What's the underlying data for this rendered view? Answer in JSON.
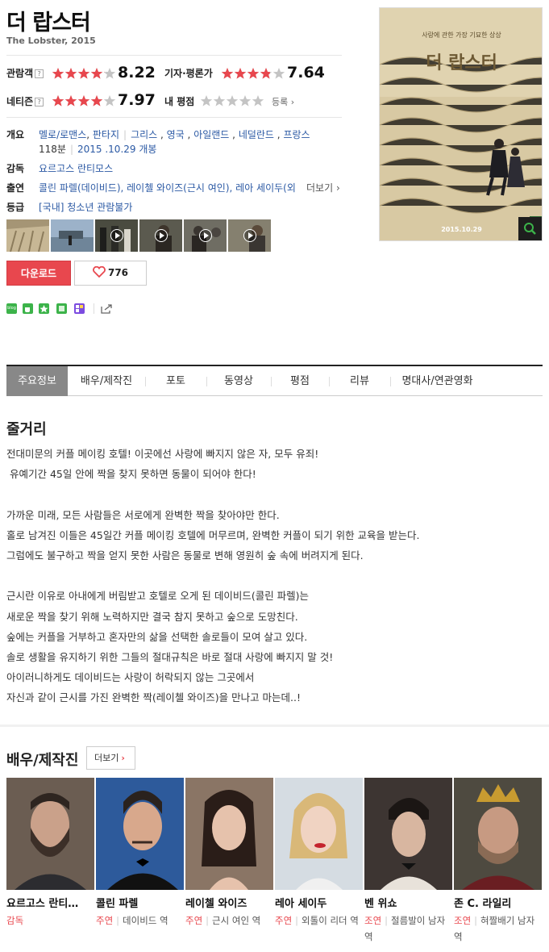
{
  "movie": {
    "title": "더 랍스터",
    "subtitle": "The Lobster, 2015"
  },
  "ratings": {
    "audience_label": "관람객",
    "audience_score": "8.22",
    "critic_label": "기자·평론가",
    "critic_score": "7.64",
    "netizen_label": "네티즌",
    "netizen_score": "7.97",
    "my_label": "내 평점",
    "register_label": "등록",
    "help_mark": "?"
  },
  "info": {
    "overview_label": "개요",
    "genres": [
      "멜로/로맨스",
      "판타지"
    ],
    "countries": [
      "그리스",
      "영국",
      "아일랜드",
      "네덜란드",
      "프랑스"
    ],
    "runtime": "118분",
    "release": "2015 .10.29 개봉",
    "director_label": "감독",
    "director": "요르고스 란티모스",
    "cast_label": "출연",
    "cast_text": "콜린 파렐(데이비드), 레이첼 와이즈(근시 여인), 레아 세이두(외...",
    "cast_more": "더보기",
    "rating_label": "등급",
    "rating_value": "[국내] 청소년 관람불가"
  },
  "poster": {
    "tagline": "사랑에 관한 가장 기묘한 상상",
    "title": "더 랍스터",
    "date": "2015.10.29",
    "zoom_icon": "search-icon"
  },
  "actions": {
    "download_label": "다운로드",
    "like_count": "776"
  },
  "share": {
    "blog_label": "blog"
  },
  "tabs": [
    "주요정보",
    "배우/제작진",
    "포토",
    "동영상",
    "평점",
    "리뷰",
    "명대사/연관영화"
  ],
  "synopsis": {
    "heading": "줄거리",
    "lines": [
      "전대미문의 커플 메이킹 호텔! 이곳에선 사랑에 빠지지 않은 자, 모두 유죄!",
      "유예기간 45일 안에 짝을 찾지 못하면 동물이 되어야 한다!",
      "",
      "가까운 미래, 모든 사람들은 서로에게 완벽한 짝을 찾아야만 한다.",
      "홀로 남겨진 이들은 45일간 커플 메이킹 호텔에 머무르며, 완벽한 커플이 되기 위한 교육을 받는다.",
      "그럼에도 불구하고 짝을 얻지 못한 사람은 동물로 변해 영원히 숲 속에 버려지게 된다.",
      "",
      "근시란 이유로 아내에게 버림받고 호텔로 오게 된 데이비드(콜린 파렐)는",
      "새로운 짝을 찾기 위해 노력하지만 결국 참지 못하고 숲으로 도망친다.",
      "숲에는 커플을 거부하고 혼자만의 삶을 선택한 솔로들이 모여 살고 있다.",
      "솔로 생활을 유지하기 위한 그들의 절대규칙은 바로 절대 사랑에 빠지지 말 것!",
      "아이러니하게도 데이비드는 사랑이 허락되지 않는 그곳에서",
      "자신과 같이 근시를 가진 완벽한 짝(레이첼 와이즈)을 만나고 마는데..!"
    ]
  },
  "cast_section": {
    "heading": "배우/제작진",
    "more_label": "더보기",
    "people": [
      {
        "name": "요르고스 란티…",
        "role": "감독",
        "character": ""
      },
      {
        "name": "콜린 파렐",
        "role": "주연",
        "character": "데이비드 역"
      },
      {
        "name": "레이첼 와이즈",
        "role": "주연",
        "character": "근시 여인 역"
      },
      {
        "name": "레아 세이두",
        "role": "주연",
        "character": "외톨이 리더 역"
      },
      {
        "name": "벤 위쇼",
        "role": "조연",
        "character": "절름발이 남자 역"
      },
      {
        "name": "존 C. 라일리",
        "role": "조연",
        "character": "혀짤배기 남자 역"
      }
    ]
  },
  "stars": {
    "audience_filled": 4.1,
    "critic_filled": 3.8,
    "netizen_filled": 4.0,
    "my_filled": 0
  },
  "colors": {
    "star_on": "#e8474e",
    "star_off": "#c4c4c4",
    "accent": "#e8474e",
    "link": "#2b59a4"
  }
}
